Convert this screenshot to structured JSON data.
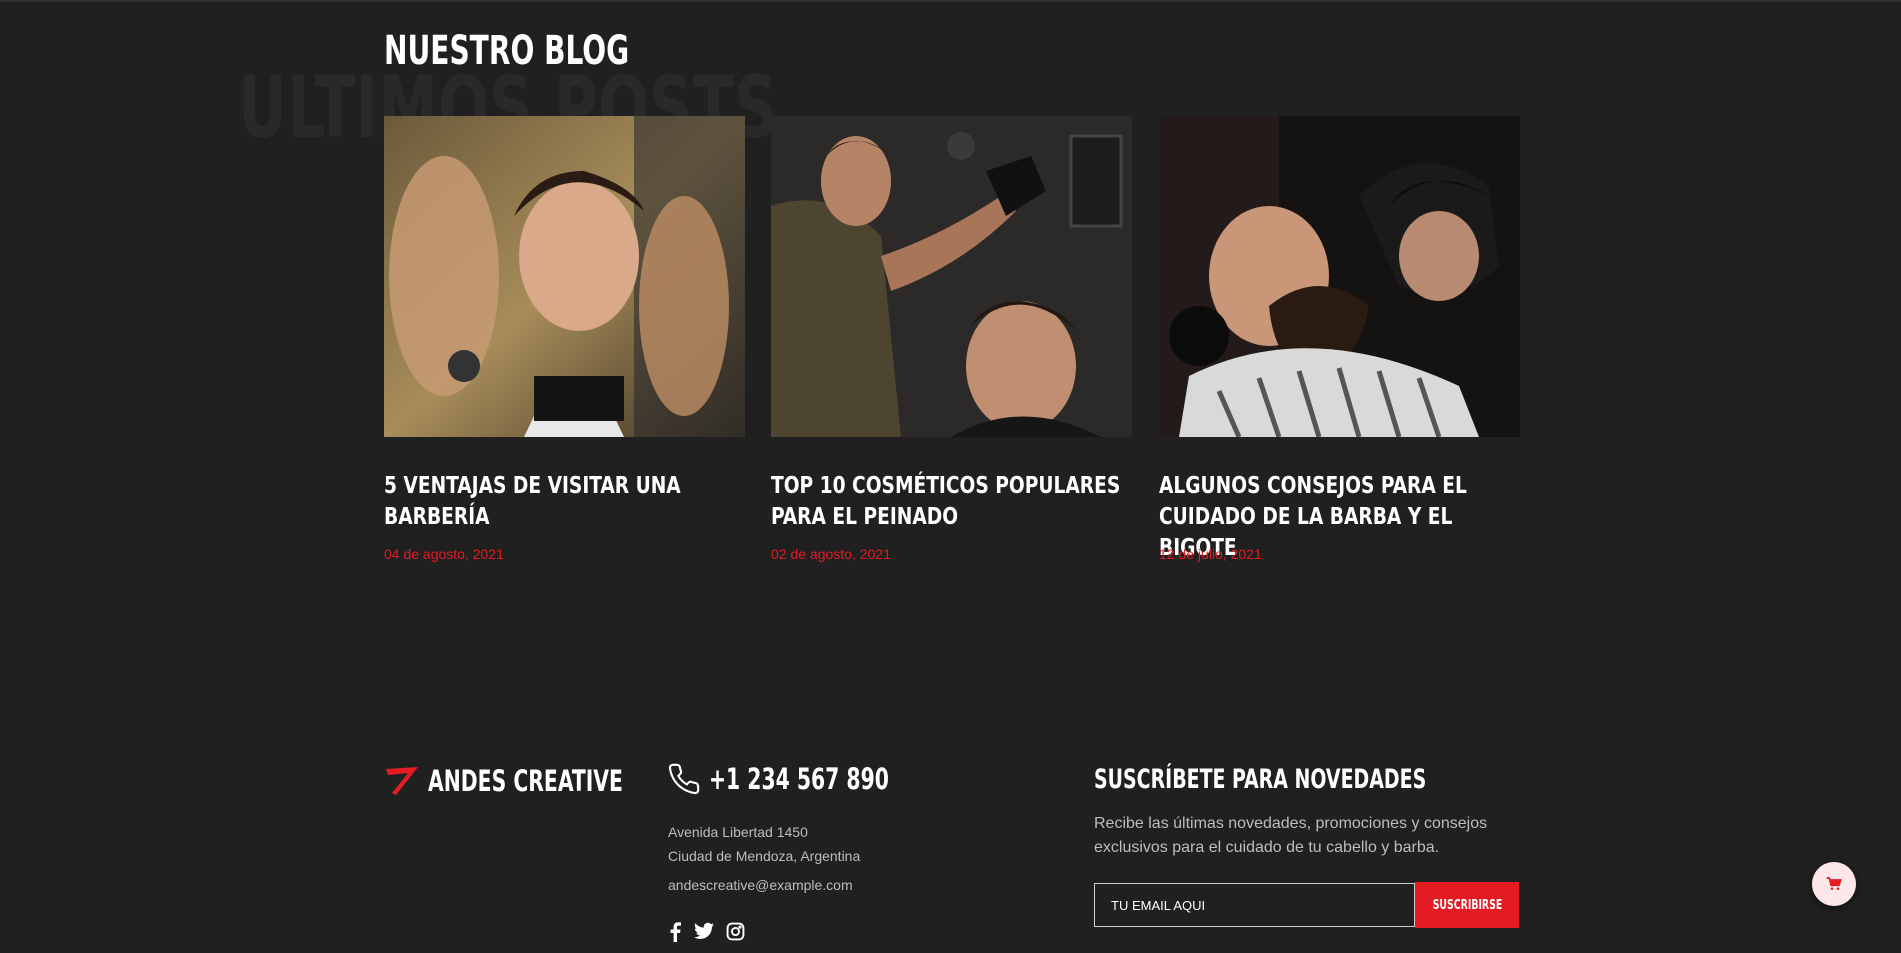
{
  "blog": {
    "background_text": "ULTIMOS POSTS",
    "title": "NUESTRO BLOG",
    "posts": [
      {
        "title": "5 VENTAJAS DE VISITAR UNA BARBERÍA",
        "date": "04 de agosto, 2021",
        "image": "barber-client-portrait-photo"
      },
      {
        "title": "TOP 10 COSMÉTICOS POPULARES PARA EL PEINADO",
        "date": "02 de agosto, 2021",
        "image": "barber-spraying-hair-photo"
      },
      {
        "title": "ALGUNOS CONSEJOS PARA EL CUIDADO DE LA BARBA Y EL BIGOTE",
        "date": "12 de julio, 2021",
        "image": "beard-trim-photo"
      }
    ]
  },
  "footer": {
    "brand": "ANDES CREATIVE",
    "phone": "+1 234 567 890",
    "address_line1": "Avenida Libertad 1450",
    "address_line2": "Ciudad de Mendoza, Argentina",
    "email": "andescreative@example.com",
    "social": [
      "facebook-icon",
      "twitter-icon",
      "instagram-icon"
    ],
    "subscribe": {
      "title": "SUSCRÍBETE PARA NOVEDADES",
      "text": "Recibe las últimas novedades, promociones y consejos exclusivos para el cuidado de tu cabello y barba.",
      "placeholder": "TU EMAIL AQUI",
      "button": "SUSCRIBIRSE"
    }
  },
  "colors": {
    "accent": "#e31b23",
    "background": "#202020"
  }
}
